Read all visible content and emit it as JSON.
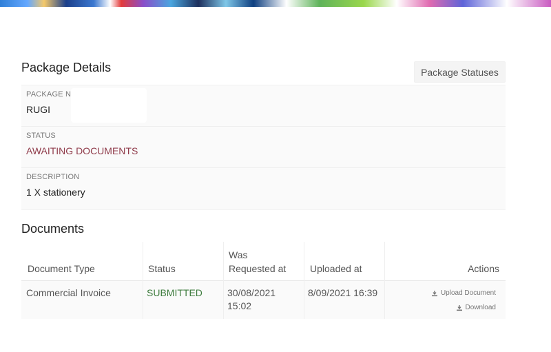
{
  "header": {
    "page_title": "Package Details",
    "statuses_button": "Package Statuses"
  },
  "details": {
    "name_label": "PACKAGE NAME",
    "name_value": "RUGI",
    "status_label": "STATUS",
    "status_value": "AWAITING DOCUMENTS",
    "description_label": "DESCRIPTION",
    "description_value": "1 X stationery"
  },
  "documents": {
    "title": "Documents",
    "columns": {
      "type": "Document Type",
      "status": "Status",
      "requested_line1": "Was",
      "requested_line2": "Requested at",
      "uploaded": "Uploaded at",
      "actions": "Actions"
    },
    "rows": [
      {
        "type": "Commercial Invoice",
        "status": "SUBMITTED",
        "requested_date": "30/08/2021",
        "requested_time": "15:02",
        "uploaded": "8/09/2021 16:39",
        "upload_action": "Upload Document",
        "download_action": "Download"
      }
    ]
  },
  "colors": {
    "awaiting": "#8f3b4a",
    "submitted": "#3e7c3e"
  },
  "icons": [
    "download-icon",
    "upload-icon"
  ]
}
